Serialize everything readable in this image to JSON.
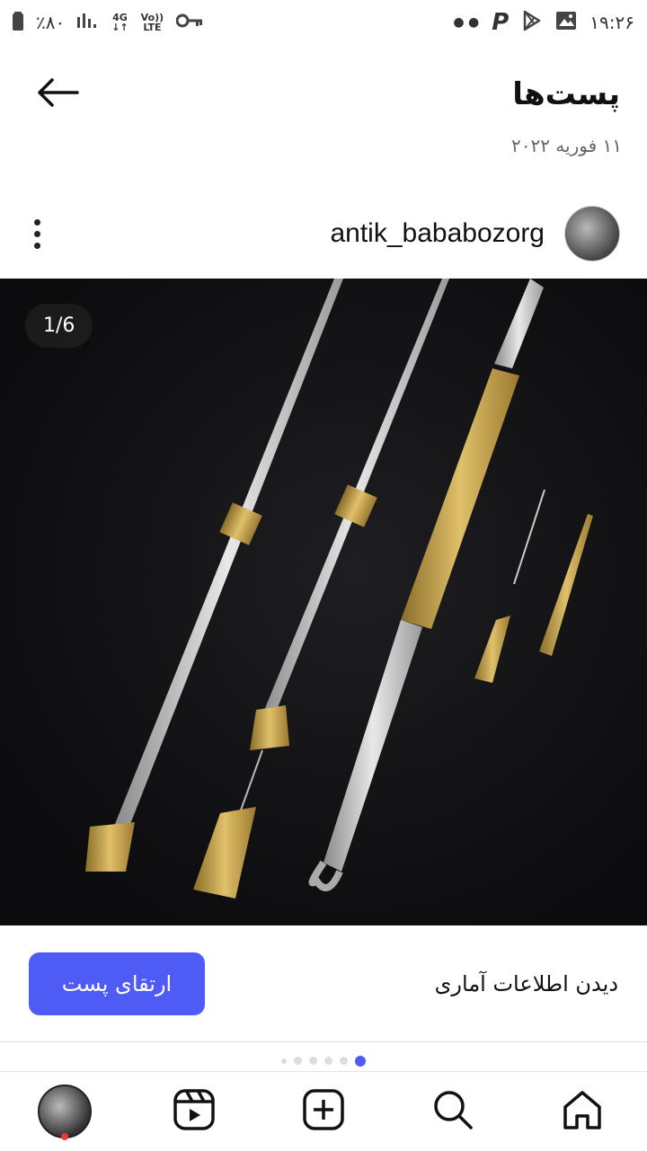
{
  "status_bar": {
    "time": "۱۹:۲۶",
    "battery": "٪۸۰",
    "network_top": "4G",
    "volte_top": "Vo))",
    "volte_bottom": "LTE"
  },
  "header": {
    "title": "پست‌ها"
  },
  "post": {
    "date": "۱۱ فوریه ۲۰۲۲",
    "username": "antik_bababozorg",
    "image_counter": "1/6",
    "view_stats_label": "دیدن اطلاعات آماری",
    "promote_label": "ارتقای پست",
    "carousel_dots": 6,
    "active_dot": 6
  },
  "colors": {
    "accent": "#4f5bf5",
    "photo_bg": "#0c0c0e"
  },
  "icons": [
    "back-arrow-icon",
    "kebab-menu-icon",
    "home-icon",
    "search-icon",
    "create-icon",
    "reels-icon"
  ]
}
